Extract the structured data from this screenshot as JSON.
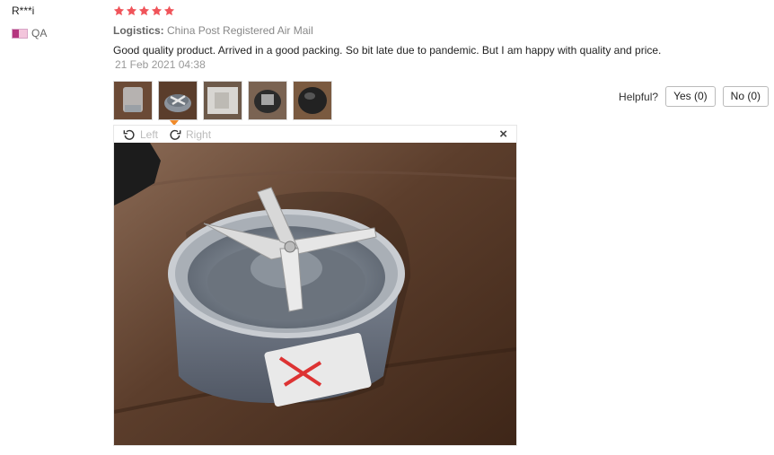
{
  "reviewer": {
    "name": "R***i",
    "country": "QA"
  },
  "rating": {
    "stars": 5,
    "max": 5,
    "color": "#f0545a"
  },
  "logistics": {
    "label": "Logistics:",
    "value": "China Post Registered Air Mail"
  },
  "review": {
    "text": "Good quality product. Arrived in a good packing. So bit late due to pandemic. But I am happy with quality and price.",
    "date": "21 Feb 2021 04:38"
  },
  "thumbnails": {
    "count": 5,
    "selected_index": 1,
    "accent": "#f08a2a"
  },
  "helpful": {
    "label": "Helpful?",
    "yes_label": "Yes (0)",
    "no_label": "No (0)"
  },
  "viewer": {
    "left_label": "Left",
    "right_label": "Right",
    "close_label": "×"
  }
}
